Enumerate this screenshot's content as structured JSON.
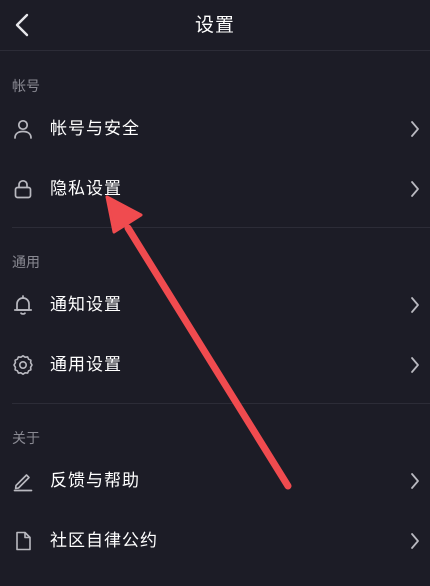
{
  "header": {
    "title": "设置",
    "back_icon": "chevron-left-icon"
  },
  "sections": [
    {
      "label": "帐号",
      "items": [
        {
          "label": "帐号与安全",
          "icon": "user-icon"
        },
        {
          "label": "隐私设置",
          "icon": "lock-icon"
        }
      ]
    },
    {
      "label": "通用",
      "items": [
        {
          "label": "通知设置",
          "icon": "bell-icon"
        },
        {
          "label": "通用设置",
          "icon": "gear-icon"
        }
      ]
    },
    {
      "label": "关于",
      "items": [
        {
          "label": "反馈与帮助",
          "icon": "edit-icon"
        },
        {
          "label": "社区自律公约",
          "icon": "document-icon"
        }
      ]
    }
  ],
  "colors": {
    "background": "#1c1c26",
    "text": "#ffffff",
    "muted_text": "#8a8a93",
    "icon_stroke": "#b9b9c0",
    "annotation_arrow": "#f04b4f"
  }
}
